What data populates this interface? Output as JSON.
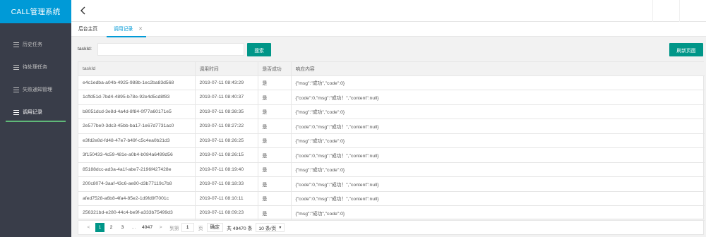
{
  "app": {
    "title": "CALL管理系统"
  },
  "sidebar": {
    "items": [
      {
        "label": "历史任务",
        "active": false
      },
      {
        "label": "待处理任务",
        "active": false
      },
      {
        "label": "失败通知管理",
        "active": false
      },
      {
        "label": "调用记录",
        "active": true
      }
    ]
  },
  "header": {
    "back_icon": "back-chevron-icon"
  },
  "tabs": {
    "home_label": "后台主页",
    "current_label": "调用记录",
    "close_glyph": "✕"
  },
  "search": {
    "label": "taskId:",
    "value": "",
    "placeholder": "",
    "button_label": "搜索",
    "refresh_label": "刷新页面"
  },
  "table": {
    "columns": [
      "taskId",
      "调用时间",
      "是否成功",
      "响应内容"
    ],
    "rows": [
      [
        "e4c1edba-a04b-4925-988b-1ec2ba83d568",
        "2019-07-11 08:43:29",
        "是",
        "{\"msg\":\"成功\",\"code\":0}"
      ],
      [
        "1cffd51d-7bd4-4895-b78e-92e4d5cd8f83",
        "2019-07-11 08:40:37",
        "是",
        "{\"code\":0,\"msg\":\"成功！\",\"content\":null}"
      ],
      [
        "b8051dcd-3e8d-4a4d-8f84-0f77a60171e5",
        "2019-07-11 08:38:35",
        "是",
        "{\"msg\":\"成功\",\"code\":0}"
      ],
      [
        "2e577be0-3dc3-45bb-ba17-1e67d7731ac0",
        "2019-07-11 08:27:22",
        "是",
        "{\"code\":0,\"msg\":\"成功！\",\"content\":null}"
      ],
      [
        "e3fd2e8d-fd48-47e7-b49f-c5c4ea0b21d3",
        "2019-07-11 08:26:25",
        "是",
        "{\"msg\":\"成功\",\"code\":0}"
      ],
      [
        "3f150433-4c59-481e-a0b4-b084a6499d56",
        "2019-07-11 08:26:15",
        "是",
        "{\"code\":0,\"msg\":\"成功！\",\"content\":null}"
      ],
      [
        "85188dcc-ad3a-4a1f-abe7-2196f427428e",
        "2019-07-11 08:19:40",
        "是",
        "{\"msg\":\"成功\",\"code\":0}"
      ],
      [
        "200c8074-3aaf-43c6-ae80-d3b77119c7b8",
        "2019-07-11 08:18:33",
        "是",
        "{\"code\":0,\"msg\":\"成功！\",\"content\":null}"
      ],
      [
        "afed7528-a6b8-4fa4-85e2-1d9fd9f7001c",
        "2019-07-11 08:10:11",
        "是",
        "{\"code\":0,\"msg\":\"成功！\",\"content\":null}"
      ],
      [
        "256321bd-e280-44c4-be9f-a333b75499d3",
        "2019-07-11 08:09:23",
        "是",
        "{\"msg\":\"成功\",\"code\":0}"
      ]
    ]
  },
  "pagination": {
    "prev": "<",
    "pages": [
      "1",
      "2",
      "3"
    ],
    "ellipsis": "…",
    "last_page": "4947",
    "next": ">",
    "goto_label": "到第",
    "goto_value": "1",
    "page_unit": "页",
    "confirm_label": "确定",
    "total_text": "共 49470 条",
    "limit_text": "10 条/页",
    "limit_caret": "▼"
  },
  "colors": {
    "brand": "#009ad7",
    "sidebar_bg": "#393d49",
    "primary_button": "#009688",
    "active_indicator": "#5fb878"
  }
}
